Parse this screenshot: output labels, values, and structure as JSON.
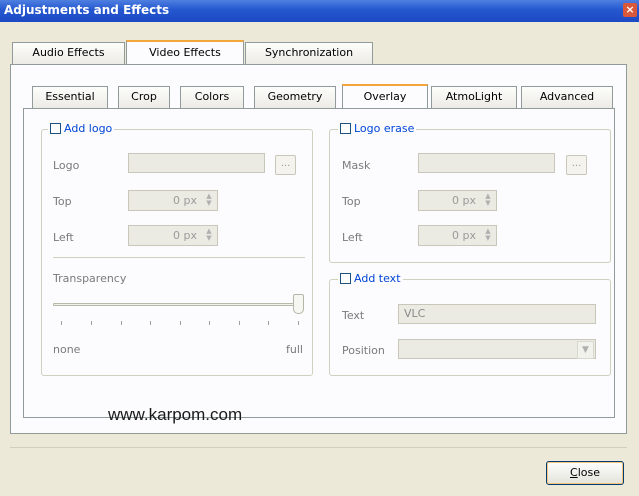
{
  "window": {
    "title": "Adjustments and Effects",
    "close_glyph": "×"
  },
  "main_tabs": [
    {
      "label": "Audio Effects",
      "active": false
    },
    {
      "label": "Video Effects",
      "active": true
    },
    {
      "label": "Synchronization",
      "active": false
    }
  ],
  "sub_tabs": [
    {
      "label": "Essential",
      "active": false
    },
    {
      "label": "Crop",
      "active": false
    },
    {
      "label": "Colors",
      "active": false
    },
    {
      "label": "Geometry",
      "active": false
    },
    {
      "label": "Overlay",
      "active": true
    },
    {
      "label": "AtmoLight",
      "active": false
    },
    {
      "label": "Advanced",
      "active": false
    }
  ],
  "add_logo": {
    "checkbox_label": "Add logo",
    "checked": false,
    "logo_label": "Logo",
    "logo_value": "",
    "browse_label": "...",
    "top_label": "Top",
    "top_value": "0 px",
    "left_label": "Left",
    "left_value": "0 px",
    "transparency_label": "Transparency",
    "transparency_level": 1.0,
    "min_label": "none",
    "max_label": "full"
  },
  "logo_erase": {
    "checkbox_label": "Logo erase",
    "checked": false,
    "mask_label": "Mask",
    "mask_value": "",
    "browse_label": "...",
    "top_label": "Top",
    "top_value": "0 px",
    "left_label": "Left",
    "left_value": "0 px"
  },
  "add_text": {
    "checkbox_label": "Add text",
    "checked": false,
    "text_label": "Text",
    "text_value": "VLC",
    "position_label": "Position",
    "position_value": ""
  },
  "watermark": "www.karpom.com",
  "buttons": {
    "close_underline": "C",
    "close_rest": "lose"
  },
  "colors": {
    "title_bar": "#2457cf",
    "group_title": "#0046d5",
    "active_tab_accent": "#f3a63a"
  }
}
